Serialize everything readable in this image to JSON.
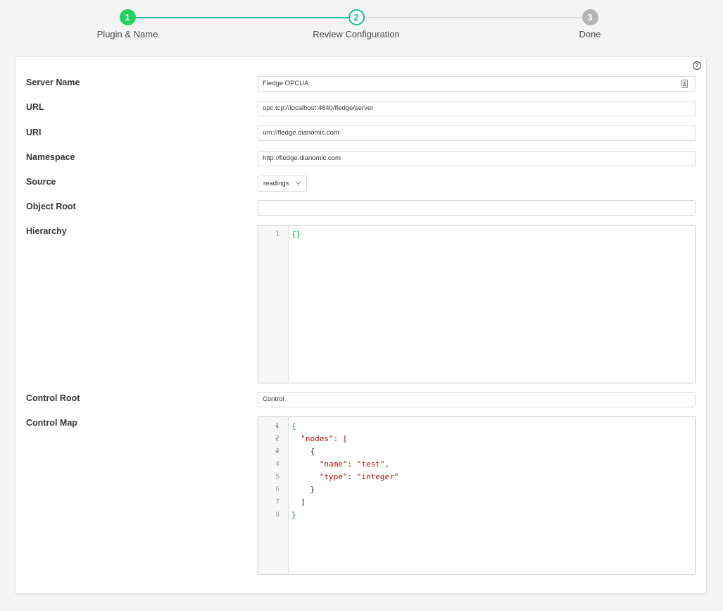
{
  "stepper": {
    "steps": [
      {
        "number": "1",
        "label": "Plugin & Name",
        "state": "completed"
      },
      {
        "number": "2",
        "label": "Review Configuration",
        "state": "active"
      },
      {
        "number": "3",
        "label": "Done",
        "state": "pending"
      }
    ]
  },
  "form": {
    "help_icon": "question-circle-icon",
    "fields": {
      "server_name": {
        "label": "Server Name",
        "value": "Fledge OPCUA"
      },
      "url": {
        "label": "URL",
        "value": "opc.tcp://localhost:4840/fledge/server"
      },
      "uri": {
        "label": "URI",
        "value": "urn://fledge.dianomic.com"
      },
      "namespace": {
        "label": "Namespace",
        "value": "http://fledge.dianomic.com"
      },
      "source": {
        "label": "Source",
        "value": "readings"
      },
      "object_root": {
        "label": "Object Root",
        "value": ""
      },
      "hierarchy": {
        "label": "Hierarchy"
      },
      "control_root": {
        "label": "Control Root",
        "value": "Control"
      },
      "control_map": {
        "label": "Control Map"
      }
    },
    "hierarchy_code": {
      "lines": [
        {
          "n": "1",
          "text": "{}"
        }
      ]
    },
    "control_map_code": {
      "lines": [
        {
          "n": "1",
          "text": "{"
        },
        {
          "n": "2",
          "text": "  \"nodes\": ["
        },
        {
          "n": "3",
          "text": "    {"
        },
        {
          "n": "4",
          "text": "      \"name\": \"test\","
        },
        {
          "n": "5",
          "text": "      \"type\": \"integer\""
        },
        {
          "n": "6",
          "text": "    }"
        },
        {
          "n": "7",
          "text": "  ]"
        },
        {
          "n": "8",
          "text": "}"
        }
      ]
    }
  },
  "colors": {
    "teal": "#1abc9c",
    "green": "#23d160",
    "grey": "#b5b5b5"
  }
}
